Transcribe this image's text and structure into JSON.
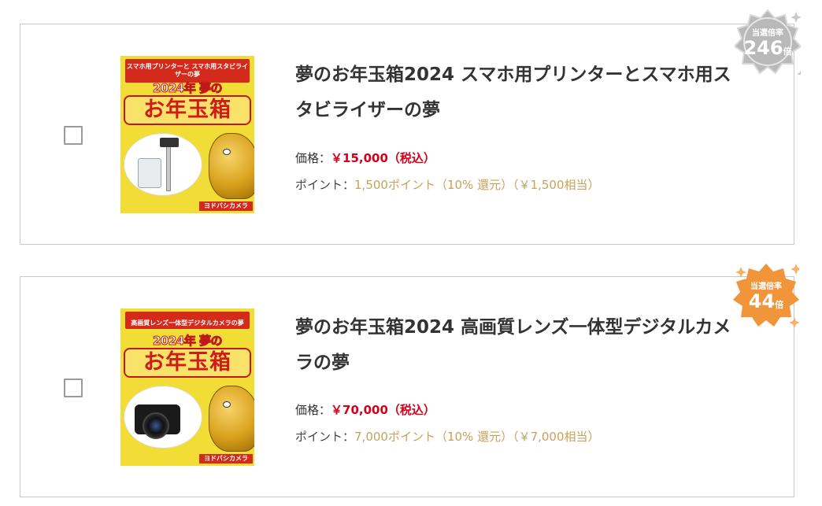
{
  "items": [
    {
      "title": "夢のお年玉箱2024 スマホ用プリンターとスマホ用スタビライザーの夢",
      "price_label": "価格：",
      "price": "￥15,000（税込）",
      "point_label": "ポイント：",
      "point": "1,500ポイント（10% 還元）（￥1,500相当）",
      "badge_label": "当選倍率",
      "badge_value": "246",
      "badge_unit": "倍",
      "badge_color": "#b9b9b9",
      "thumb": {
        "banner": "スマホ用プリンターと スマホ用スタビライザーの夢",
        "year": "2024年 夢の",
        "big": "お年玉箱",
        "logo": "ヨドバシカメラ",
        "product_icon": "printer-and-gimbal"
      }
    },
    {
      "title": "夢のお年玉箱2024 高画質レンズ一体型デジタルカメラの夢",
      "price_label": "価格：",
      "price": "￥70,000（税込）",
      "point_label": "ポイント：",
      "point": "7,000ポイント（10% 還元）（￥7,000相当）",
      "badge_label": "当選倍率",
      "badge_value": "44",
      "badge_unit": "倍",
      "badge_color": "#f0953a",
      "thumb": {
        "banner": "高画質レンズ一体型デジタルカメラの夢",
        "year": "2024年 夢の",
        "big": "お年玉箱",
        "logo": "ヨドバシカメラ",
        "product_icon": "digital-camera"
      }
    }
  ]
}
